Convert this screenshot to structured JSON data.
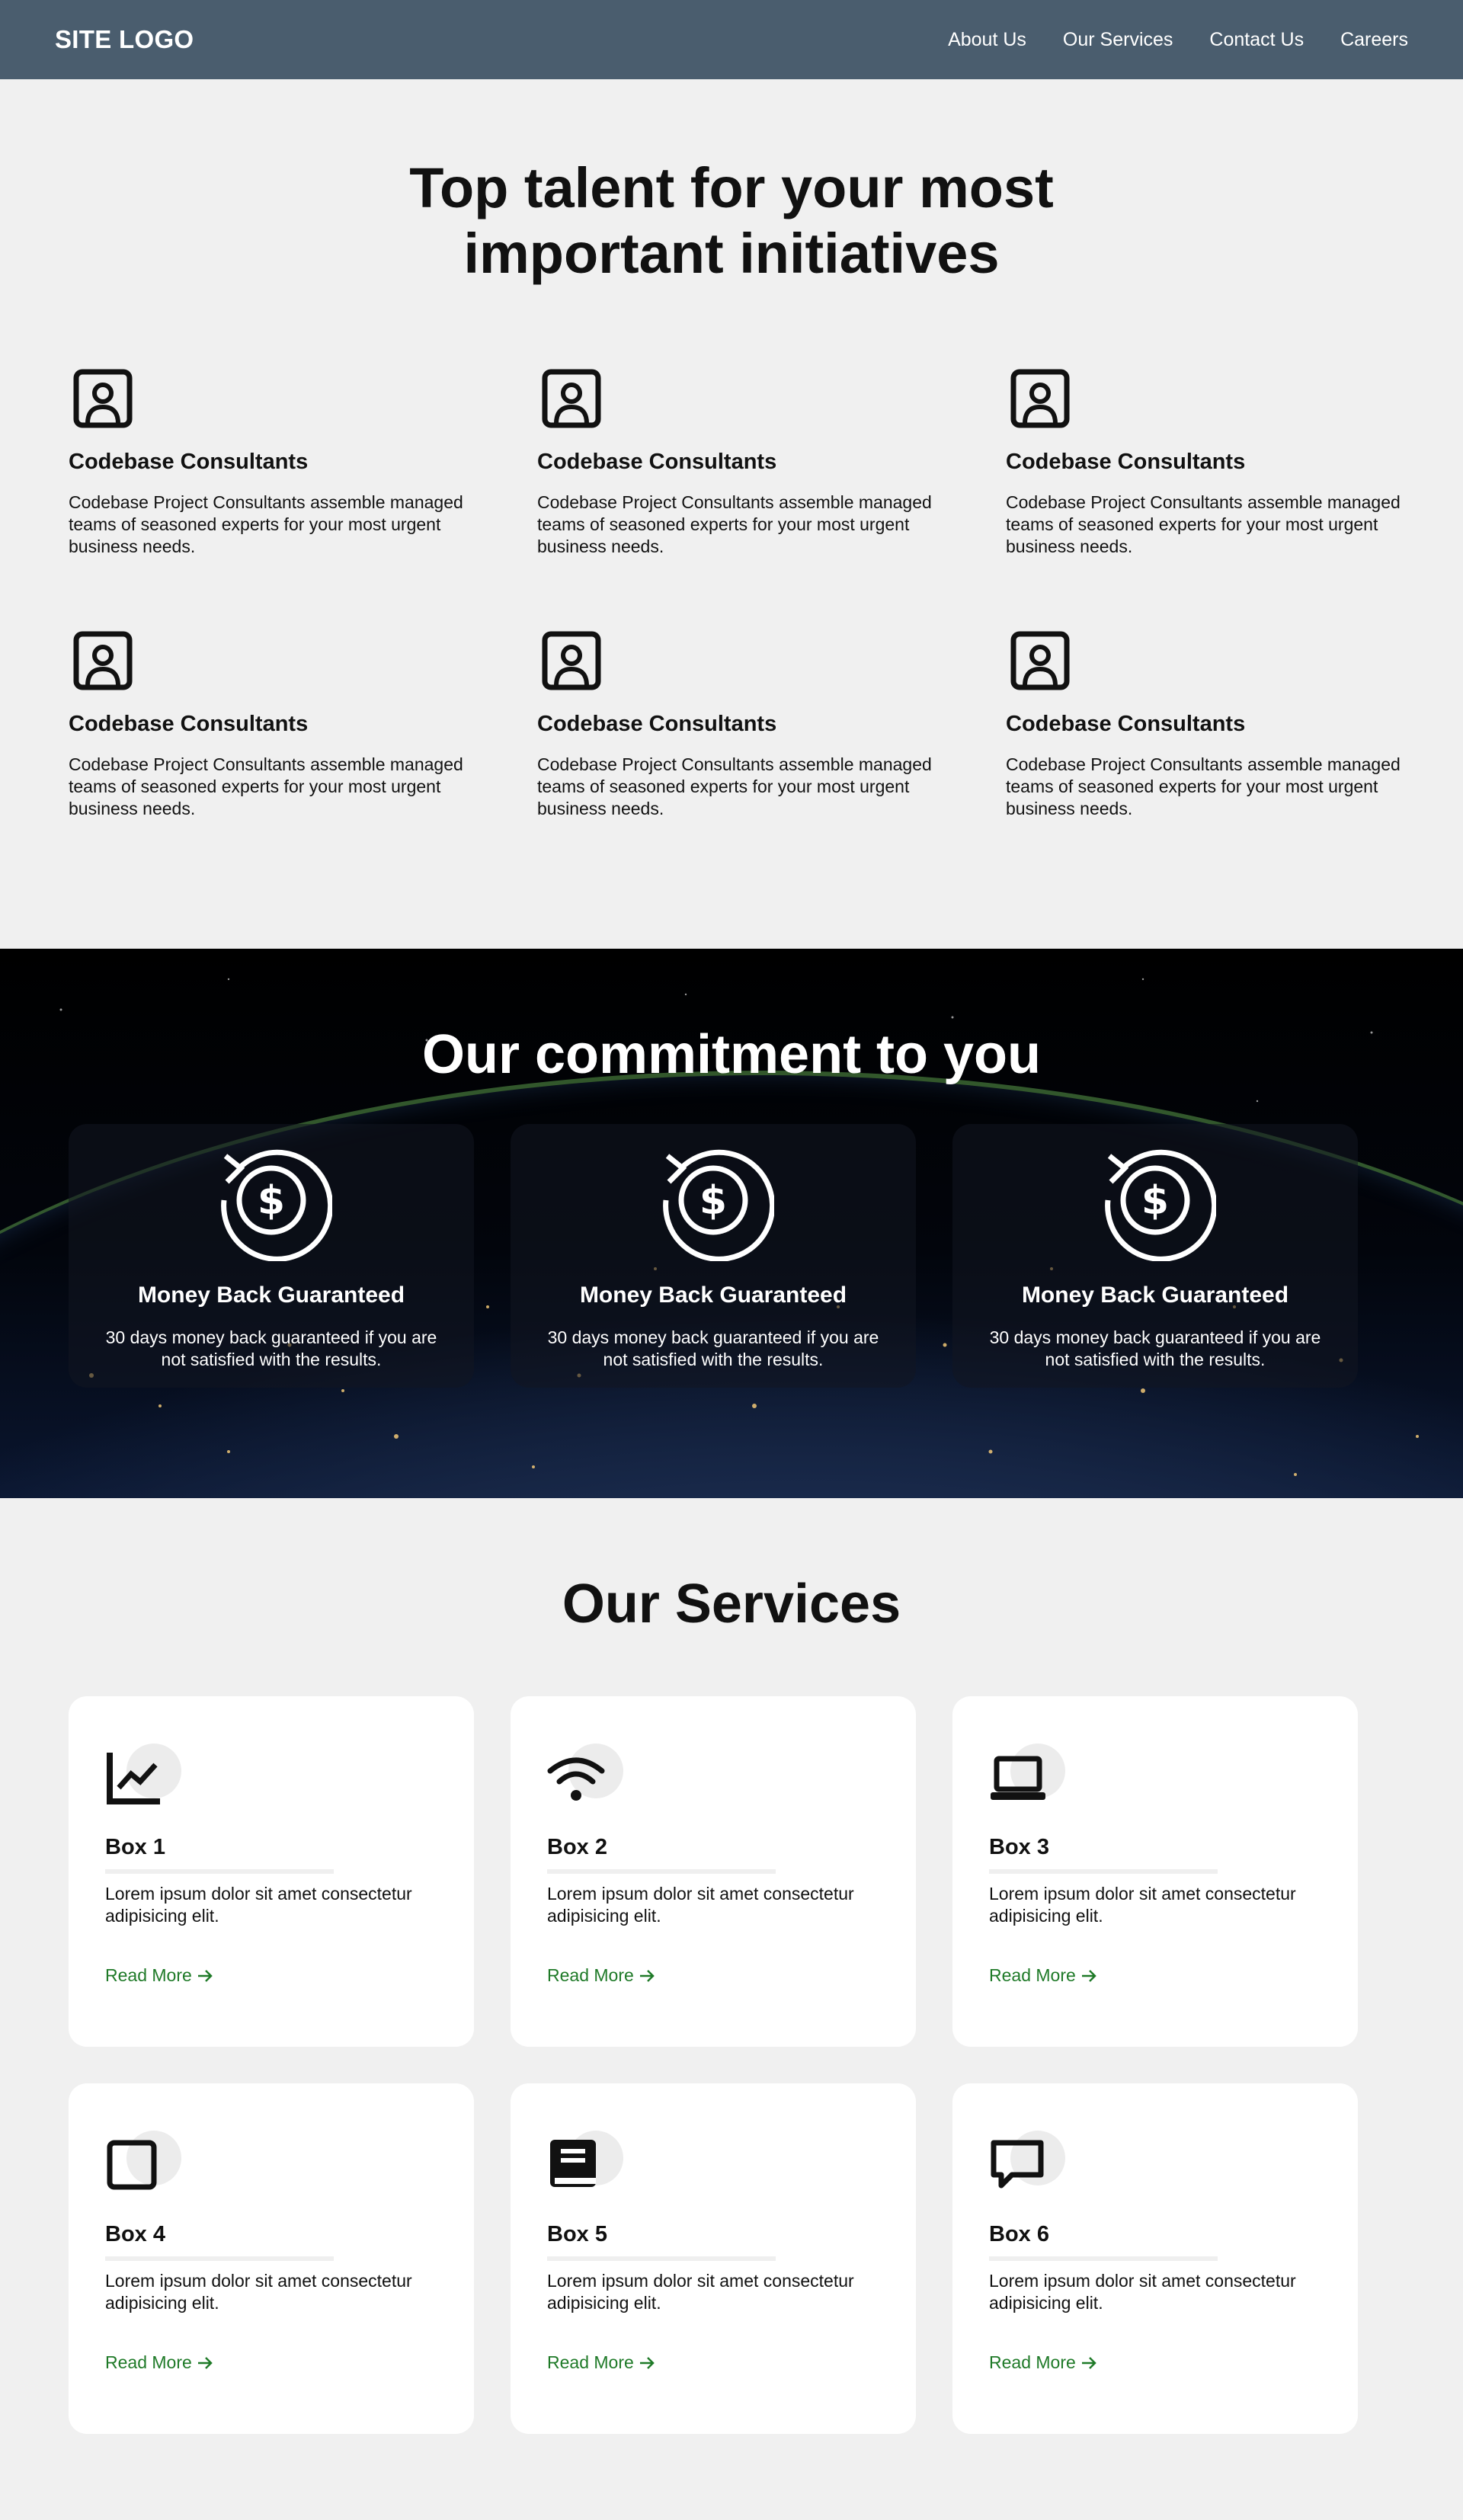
{
  "header": {
    "logo": "SITE LOGO",
    "nav": [
      "About Us",
      "Our Services",
      "Contact Us",
      "Careers"
    ]
  },
  "talent": {
    "title": "Top talent for your most important initiatives",
    "items": [
      {
        "icon": "user-square-icon",
        "title": "Codebase Consultants",
        "text": "Codebase Project Consultants assemble managed teams of seasoned experts for your most urgent business needs."
      },
      {
        "icon": "user-square-icon",
        "title": "Codebase Consultants",
        "text": "Codebase Project Consultants assemble managed teams of seasoned experts for your most urgent business needs."
      },
      {
        "icon": "user-square-icon",
        "title": "Codebase Consultants",
        "text": "Codebase Project Consultants assemble managed teams of seasoned experts for your most urgent business needs."
      },
      {
        "icon": "user-square-icon",
        "title": "Codebase Consultants",
        "text": "Codebase Project Consultants assemble managed teams of seasoned experts for your most urgent business needs."
      },
      {
        "icon": "user-square-icon",
        "title": "Codebase Consultants",
        "text": "Codebase Project Consultants assemble managed teams of seasoned experts for your most urgent business needs."
      },
      {
        "icon": "user-square-icon",
        "title": "Codebase Consultants",
        "text": "Codebase Project Consultants assemble managed teams of seasoned experts for your most urgent business needs."
      }
    ]
  },
  "commitment": {
    "title": "Our commitment to you",
    "cards": [
      {
        "icon": "money-back-icon",
        "title": "Money Back Guaranteed",
        "text": "30 days money back guaranteed if you are not satisfied with the results."
      },
      {
        "icon": "money-back-icon",
        "title": "Money Back Guaranteed",
        "text": "30 days money back guaranteed if you are not satisfied with the results."
      },
      {
        "icon": "money-back-icon",
        "title": "Money Back Guaranteed",
        "text": "30 days money back guaranteed if you are not satisfied with the results."
      }
    ]
  },
  "services": {
    "title": "Our Services",
    "link_color": "#1f7a28",
    "cards": [
      {
        "icon": "chart-line-icon",
        "title": "Box 1",
        "text": "Lorem ipsum dolor sit amet consectetur adipisicing elit.",
        "link": "Read More"
      },
      {
        "icon": "wifi-icon",
        "title": "Box 2",
        "text": "Lorem ipsum dolor sit amet consectetur adipisicing elit.",
        "link": "Read More"
      },
      {
        "icon": "laptop-icon",
        "title": "Box 3",
        "text": "Lorem ipsum dolor sit amet consectetur adipisicing elit.",
        "link": "Read More"
      },
      {
        "icon": "square-icon",
        "title": "Box 4",
        "text": "Lorem ipsum dolor sit amet consectetur adipisicing elit.",
        "link": "Read More"
      },
      {
        "icon": "book-icon",
        "title": "Box 5",
        "text": "Lorem ipsum dolor sit amet consectetur adipisicing elit.",
        "link": "Read More"
      },
      {
        "icon": "message-icon",
        "title": "Box 6",
        "text": "Lorem ipsum dolor sit amet consectetur adipisicing elit.",
        "link": "Read More"
      }
    ]
  }
}
